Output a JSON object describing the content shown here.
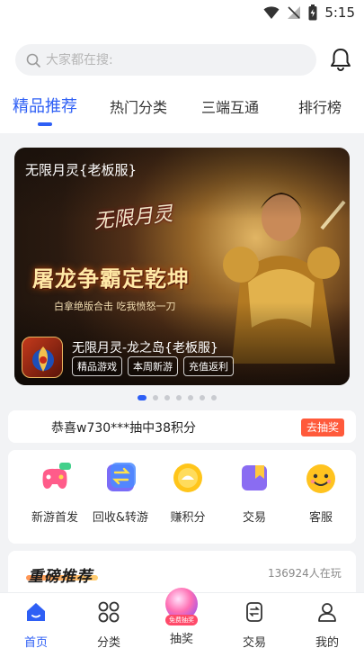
{
  "status_bar": {
    "time": "5:15"
  },
  "search": {
    "placeholder": "大家都在搜:"
  },
  "tabs": [
    {
      "label": "精品推荐"
    },
    {
      "label": "热门分类"
    },
    {
      "label": "三端互通"
    },
    {
      "label": "排行榜"
    }
  ],
  "banner": {
    "title": "无限月灵{老板服}",
    "logo_text": "无限月灵",
    "slogan": "屠龙争霸定乾坤",
    "subslogan": "白拿绝版合击 吃我愤怒一刀",
    "game_name": "无限月灵-龙之岛{老板服}",
    "tags": [
      "精品游戏",
      "本周新游",
      "充值返利"
    ]
  },
  "ticker": {
    "message": "恭喜w730***抽中38积分",
    "button": "去抽奖"
  },
  "grid": [
    {
      "label": "新游首发",
      "icon": "gamepad-new-icon"
    },
    {
      "label": "回收&转游",
      "icon": "exchange-icon"
    },
    {
      "label": "赚积分",
      "icon": "coin-icon"
    },
    {
      "label": "交易",
      "icon": "trade-bookmark-icon"
    },
    {
      "label": "客服",
      "icon": "smiley-service-icon"
    }
  ],
  "featured": {
    "title": "重磅推荐",
    "online": "136924人在玩"
  },
  "bottom_nav": [
    {
      "label": "首页",
      "active": true
    },
    {
      "label": "分类"
    },
    {
      "label": "抽奖",
      "badge": "免费抽奖"
    },
    {
      "label": "交易"
    },
    {
      "label": "我的"
    }
  ],
  "colors": {
    "accent": "#2e5ff5",
    "hot": "#ff5a3b"
  }
}
